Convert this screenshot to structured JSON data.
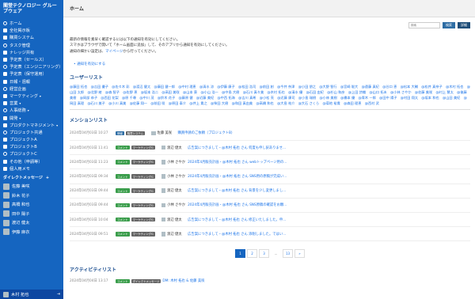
{
  "sidebar": {
    "title": "閣堂テクノロジー グループウェア",
    "items": [
      {
        "label": "ホーム",
        "icon": "home-icon"
      },
      {
        "label": "全社掲示板",
        "icon": "board-icon"
      },
      {
        "label": "購買システム",
        "icon": "cart-icon"
      },
      {
        "label": "タスク管理",
        "icon": "task-icon"
      },
      {
        "label": "ナレッジ共有",
        "icon": "book-icon"
      },
      {
        "label": "予定表（セールス）",
        "icon": "calendar-icon"
      },
      {
        "label": "予定表（エンジニアリング）",
        "icon": "calendar-icon"
      },
      {
        "label": "予定表（保守運用）",
        "icon": "calendar-icon"
      },
      {
        "label": "日報・週報",
        "icon": "report-icon"
      },
      {
        "label": "経営企画",
        "icon": "chart-icon"
      },
      {
        "label": "マーケティング",
        "icon": "megaphone-icon",
        "chevron": true
      },
      {
        "label": "営業",
        "icon": "briefcase-icon",
        "chevron": true
      },
      {
        "label": "人事総務",
        "icon": "people-icon",
        "chevron": true
      },
      {
        "label": "開発",
        "icon": "code-icon",
        "chevron": true
      },
      {
        "label": "プロダクトマネジメント",
        "icon": "product-icon",
        "chevron": true
      },
      {
        "label": "プロジェクト共通",
        "icon": "folder-icon"
      },
      {
        "label": "プロジェクトA",
        "icon": "folder-icon"
      },
      {
        "label": "プロジェクトB",
        "icon": "folder-icon"
      },
      {
        "label": "プロジェクトC",
        "icon": "folder-icon"
      },
      {
        "label": "その他（申請等）",
        "icon": "info-icon"
      },
      {
        "label": "個人用メモ",
        "icon": "memo-icon"
      }
    ],
    "dm_header": "ダイレクトメッセージ",
    "dm_plus": "+",
    "dms": [
      "佐藤 美咲",
      "鈴木 花子",
      "高橋 和也",
      "田中 陽子",
      "渡辺 健太",
      "伊藤 麻衣"
    ],
    "footer_user": "木村 拓也",
    "footer_icon": "logout-icon"
  },
  "header": {
    "title": "ホーム"
  },
  "search": {
    "placeholder": "検索",
    "search_label": "検索",
    "detail_label": "詳細"
  },
  "description": {
    "line1": "最新の情報を素早く確認するには以下の通知を有効にしてください。",
    "line2": "スマホはブラウザで開いて「ホーム画面に追加」して、そのアプリから通知を有効にしてください。",
    "line3_prefix": "通知の細かい設定は、",
    "line3_link": "マイページ",
    "line3_suffix": "から行ってください。",
    "enable_link": "通知を有効にする"
  },
  "user_list": {
    "title": "ユーザーリスト",
    "users": [
      "@藤田 拓也",
      "@吉田 優子",
      "@佐々木 彩",
      "@渡辺 健太",
      "@藤田 健一郎",
      "@中村 理恵",
      "@清水 涼",
      "@伊藤 康子",
      "@松田 浩司",
      "@前田 創",
      "@今井 奈津",
      "@小田 朋之",
      "@大野 智行",
      "@宮崎 聡大",
      "@遠藤 真紀",
      "@谷口 恵",
      "@松本 大輔",
      "@松井 真奈子",
      "@木村 拓也",
      "@山田 太郎",
      "@北野 綾",
      "@森 智子",
      "@佐野 恵",
      "@坂本 浩二",
      "@高田 美咲",
      "@山本 葵",
      "@小山 浩一",
      "@中島 大樹",
      "@石川 真々美",
      "@木村 拓也",
      "@清水 優",
      "@石田 由紀",
      "@杉山 和彦",
      "@上田 詩織",
      "@山口 拓未",
      "@小林 さやか",
      "@佐藤 美咲",
      "@村上 慧太",
      "@後藤 美樹",
      "@岡部 恭子",
      "@西田 花梨",
      "@原 千尋",
      "@中川 茂",
      "@鈴木 花子",
      "@藤原 健",
      "@近藤 美紀",
      "@中西 拓海",
      "@吉川 真希",
      "@小松 亮",
      "@近藤 康司",
      "@小島 瑞樹",
      "@小林 美樹",
      "@橋本 優",
      "@青木 一郎",
      "@田中 陽子",
      "@村田 翔太",
      "@坂本 和也",
      "@山田 美紀",
      "@岡田 真理",
      "@石川 美子",
      "@小川 真美",
      "@佐藤 翔一",
      "@前田 咲",
      "@原田 泰介",
      "@井上 貴之",
      "@柴田 大樹",
      "@和田 真由美",
      "@高橋 和也",
      "@大島 祐介",
      "@大石 さくら",
      "@菊地 裕貴",
      "@森田 理恵",
      "@西村 武"
    ]
  },
  "mention_list": {
    "title": "メンションリスト",
    "items": [
      {
        "date": "2024年04月03日 10:27",
        "tags": [
          {
            "label": "情報",
            "color": "blue"
          },
          {
            "label": "購買システム",
            "color": "gray"
          }
        ],
        "user": "佐藤 美咲",
        "message": "購買申請のご依頼（プロジェクトB）"
      },
      {
        "date": "2024年04月03日 11:41",
        "tags": [
          {
            "label": "コメント",
            "color": "green"
          },
          {
            "label": "マーケティングG",
            "color": "gray"
          }
        ],
        "user": "渡辺 健太",
        "message": "広告案につきまして・@木村 拓也 さん 何度も申し訳ありませ..."
      },
      {
        "date": "2024年04月03日 11:23",
        "tags": [
          {
            "label": "コメント",
            "color": "green"
          },
          {
            "label": "マーケティングG",
            "color": "gray"
          }
        ],
        "user": "小林 さやか",
        "message": "2024年4月販売計画・@木村 拓也 さん webトップページ用の..."
      },
      {
        "date": "2024年04月03日 09:34",
        "tags": [
          {
            "label": "コメント",
            "color": "green"
          },
          {
            "label": "マーケティングG",
            "color": "gray"
          }
        ],
        "user": "小林 さやか",
        "message": "2024年4月販売計画・@木村 拓也 さん SNS用の原稿が完成い..."
      },
      {
        "date": "2024年04月03日 09:44",
        "tags": [
          {
            "label": "コメント",
            "color": "green"
          },
          {
            "label": "マーケティングG",
            "color": "gray"
          }
        ],
        "user": "渡辺 健太",
        "message": "広告案につきまして・@木村 拓也 さん 背景を少し変更しまし..."
      },
      {
        "date": "2024年04月03日 09:44",
        "tags": [
          {
            "label": "コメント",
            "color": "green"
          },
          {
            "label": "マーケティングG",
            "color": "gray"
          }
        ],
        "user": "小林 さやか",
        "message": "2024年4月販売計画・@木村 拓也 さん SNS原稿の確認をお願..."
      },
      {
        "date": "2024年04月03日 10:04",
        "tags": [
          {
            "label": "コメント",
            "color": "green"
          },
          {
            "label": "マーケティングG",
            "color": "gray"
          }
        ],
        "user": "渡辺 健太",
        "message": "広告案につきまして・@木村 拓也 さん 修正いたしました。申..."
      },
      {
        "date": "2024年04月03日 09:51",
        "tags": [
          {
            "label": "コメント",
            "color": "green"
          },
          {
            "label": "マーケティングG",
            "color": "gray"
          }
        ],
        "user": "渡辺 健太",
        "message": "広告案につきまして・@木村 拓也 さん 添削しました。ではい..."
      }
    ]
  },
  "pagination": {
    "pages": [
      "1",
      "2",
      "3",
      "...",
      "13",
      "»"
    ],
    "active": "1"
  },
  "activity_list": {
    "title": "アクティビティリスト",
    "items": [
      {
        "date": "2024年04月04日 13:17",
        "tags": [
          {
            "label": "コメント",
            "color": "green"
          },
          {
            "label": "ダイレクトメッセージ",
            "color": "gray"
          }
        ],
        "message": "DM: 木村 拓也 & 佐藤 美咲"
      }
    ]
  },
  "colors": {
    "sidebar_bg": "#1565c0",
    "link": "#1a73e8",
    "heading": "#1a4d8f",
    "tag_green": "#3a9d4b"
  }
}
